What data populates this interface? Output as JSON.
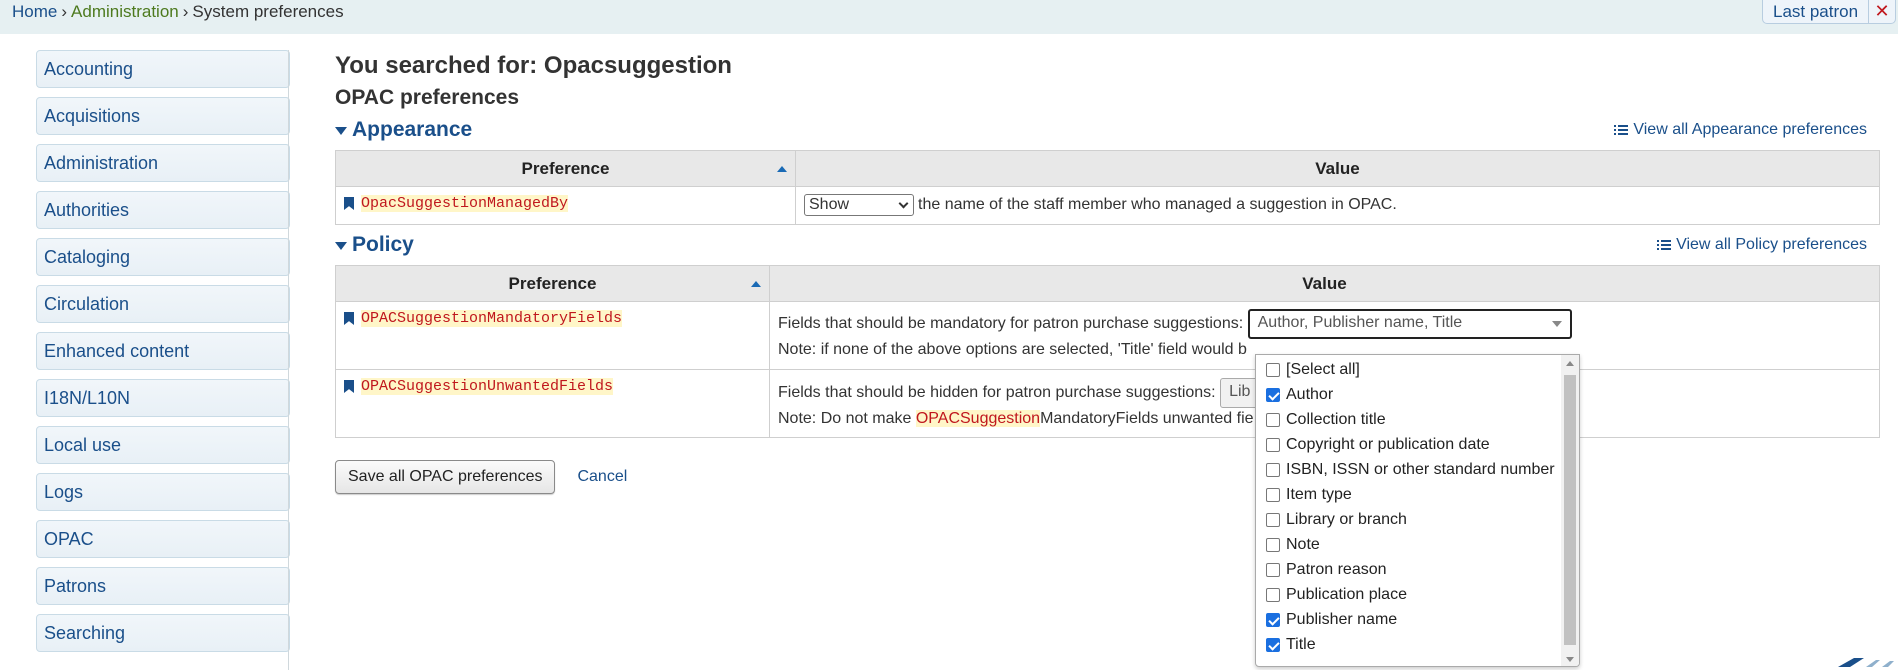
{
  "breadcrumb": {
    "home": "Home",
    "separator": "›",
    "administration": "Administration",
    "current": "System preferences"
  },
  "header": {
    "last_patron": "Last patron",
    "close_glyph": "✕"
  },
  "sidebar": {
    "items": [
      {
        "label": "Accounting"
      },
      {
        "label": "Acquisitions"
      },
      {
        "label": "Administration"
      },
      {
        "label": "Authorities"
      },
      {
        "label": "Cataloging"
      },
      {
        "label": "Circulation"
      },
      {
        "label": "Enhanced content"
      },
      {
        "label": "I18N/L10N"
      },
      {
        "label": "Local use"
      },
      {
        "label": "Logs"
      },
      {
        "label": "OPAC"
      },
      {
        "label": "Patrons"
      },
      {
        "label": "Searching"
      }
    ]
  },
  "main": {
    "search_title": "You searched for: Opacsuggestion",
    "section_title": "OPAC preferences",
    "columns": {
      "preference": "Preference",
      "value": "Value"
    },
    "appearance": {
      "title": "Appearance",
      "view_all": "View all Appearance preferences",
      "rows": [
        {
          "name": "OpacSuggestionManagedBy",
          "select_value": "Show",
          "text": "the name of the staff member who managed a suggestion in OPAC."
        }
      ]
    },
    "policy": {
      "title": "Policy",
      "view_all": "View all Policy preferences",
      "mandatory": {
        "name": "OPACSuggestionMandatoryFields",
        "text": "Fields that should be mandatory for patron purchase suggestions:",
        "selected": "Author, Publisher name, Title",
        "note": "Note: if none of the above options are selected, 'Title' field would b"
      },
      "unwanted": {
        "name": "OPACSuggestionUnwantedFields",
        "text": "Fields that should be hidden for patron purchase suggestions:",
        "button": "Lib",
        "note_pre": "Note: Do not make ",
        "note_hl": "OPACSuggestion",
        "note_post": "MandatoryFields unwanted fie"
      }
    },
    "save_label": "Save all OPAC preferences",
    "cancel_label": "Cancel"
  },
  "dropdown": {
    "options": [
      {
        "label": "[Select all]",
        "checked": false
      },
      {
        "label": "Author",
        "checked": true
      },
      {
        "label": "Collection title",
        "checked": false
      },
      {
        "label": "Copyright or publication date",
        "checked": false
      },
      {
        "label": "ISBN, ISSN or other standard number",
        "checked": false
      },
      {
        "label": "Item type",
        "checked": false
      },
      {
        "label": "Library or branch",
        "checked": false
      },
      {
        "label": "Note",
        "checked": false
      },
      {
        "label": "Patron reason",
        "checked": false
      },
      {
        "label": "Publication place",
        "checked": false
      },
      {
        "label": "Publisher name",
        "checked": true
      },
      {
        "label": "Title",
        "checked": true
      }
    ]
  },
  "colors": {
    "link": "#1a4f8a",
    "admin_link": "#4d7a1e",
    "highlight_text": "#c0171d",
    "highlight_bg": "#fff6c8",
    "checkbox_on": "#1a6fe0"
  }
}
